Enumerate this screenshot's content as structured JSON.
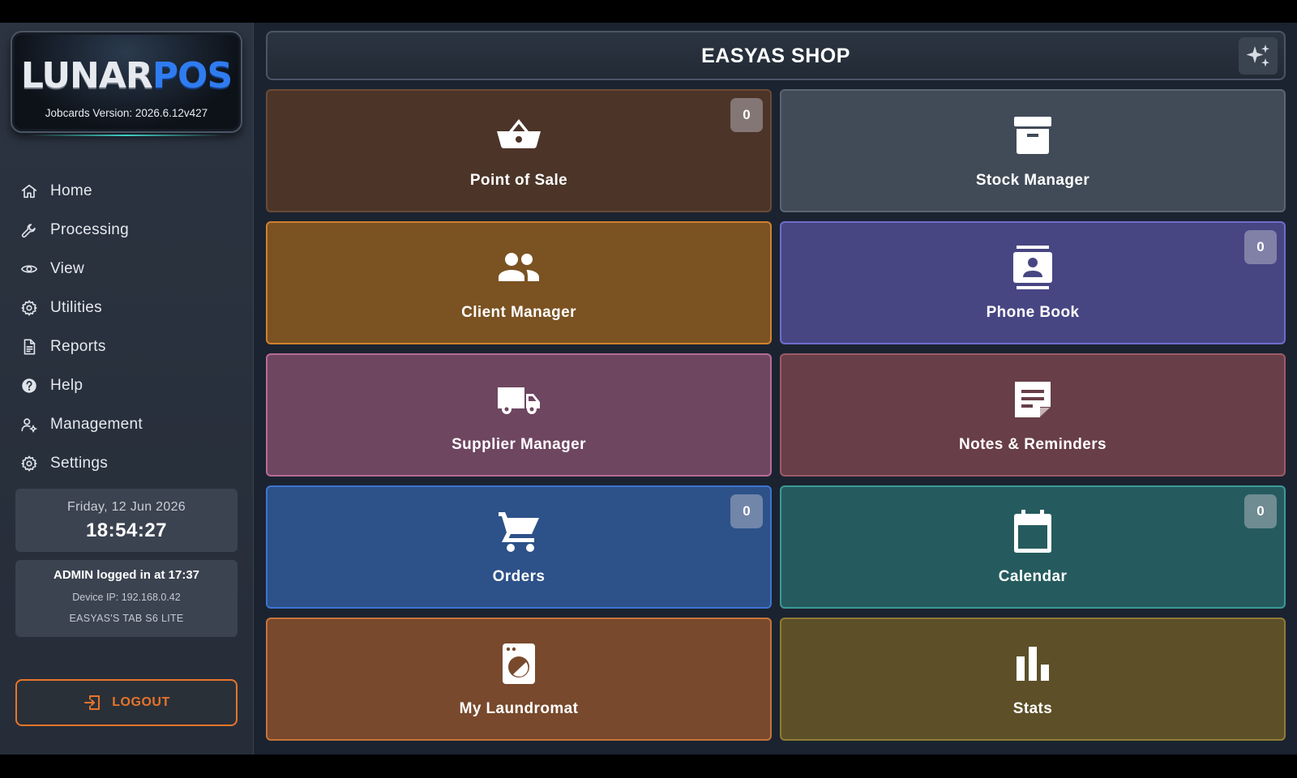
{
  "brand": {
    "logo_lunar": "LUNAR",
    "logo_pos": "POS",
    "version": "Jobcards Version: 2026.6.12v427"
  },
  "nav": {
    "items": [
      {
        "label": "Home",
        "icon": "home-icon"
      },
      {
        "label": "Processing",
        "icon": "wrench-icon"
      },
      {
        "label": "View",
        "icon": "eye-icon"
      },
      {
        "label": "Utilities",
        "icon": "gear-icon"
      },
      {
        "label": "Reports",
        "icon": "document-icon"
      },
      {
        "label": "Help",
        "icon": "help-icon"
      },
      {
        "label": "Management",
        "icon": "user-gear-icon"
      },
      {
        "label": "Settings",
        "icon": "gear-icon"
      }
    ]
  },
  "clock": {
    "date": "Friday, 12 Jun 2026",
    "time": "18:54:27"
  },
  "session": {
    "user_line": "ADMIN logged in at 17:37",
    "device_ip": "Device IP: 192.168.0.42",
    "device_name": "EASYAS'S TAB S6 LITE"
  },
  "logout": {
    "label": "LOGOUT",
    "icon": "logout-icon"
  },
  "header": {
    "title": "EASYAS SHOP",
    "action_icon": "sparkle-icon"
  },
  "tiles": [
    {
      "label": "Point of Sale",
      "icon": "basket-icon",
      "badge": "0",
      "color": "#4c3428"
    },
    {
      "label": "Stock Manager",
      "icon": "archive-icon",
      "badge": null,
      "color": "#414b58"
    },
    {
      "label": "Client Manager",
      "icon": "people-icon",
      "badge": null,
      "color": "#7b5222"
    },
    {
      "label": "Phone Book",
      "icon": "contact-book-icon",
      "badge": "0",
      "color": "#474683"
    },
    {
      "label": "Supplier Manager",
      "icon": "truck-icon",
      "badge": null,
      "color": "#6e4660"
    },
    {
      "label": "Notes & Reminders",
      "icon": "note-icon",
      "badge": null,
      "color": "#683e48"
    },
    {
      "label": "Orders",
      "icon": "cart-icon",
      "badge": "0",
      "color": "#2d5189"
    },
    {
      "label": "Calendar",
      "icon": "calendar-icon",
      "badge": "0",
      "color": "#255b5e"
    },
    {
      "label": "My Laundromat",
      "icon": "washing-machine-icon",
      "badge": null,
      "color": "#78492c"
    },
    {
      "label": "Stats",
      "icon": "bar-chart-icon",
      "badge": null,
      "color": "#5d5028"
    }
  ]
}
